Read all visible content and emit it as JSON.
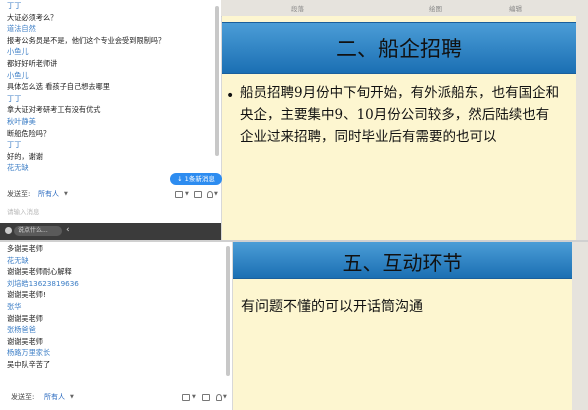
{
  "top": {
    "ribbon": [
      "段落",
      "绘图",
      "编辑"
    ],
    "messages": [
      {
        "type": "name",
        "text": "丁丁"
      },
      {
        "type": "text",
        "text": "大证必须考么？"
      },
      {
        "type": "name",
        "text": "道法自然"
      },
      {
        "type": "text",
        "text": "报考公务员是不是，他们这个专业会受到限制吗？"
      },
      {
        "type": "name",
        "text": "小鱼儿"
      },
      {
        "type": "text",
        "text": "都好好听老师讲"
      },
      {
        "type": "name",
        "text": "小鱼儿"
      },
      {
        "type": "text",
        "text": "具体怎么选 看孩子自己想去哪里"
      },
      {
        "type": "name",
        "text": "丁丁"
      },
      {
        "type": "text",
        "text": "拿大证对考研考工有没有优式"
      },
      {
        "type": "name",
        "text": "秋叶静美"
      },
      {
        "type": "text",
        "text": "断船危险吗？"
      },
      {
        "type": "name",
        "text": "丁丁"
      },
      {
        "type": "text",
        "text": "好的，谢谢"
      },
      {
        "type": "name",
        "text": "花无缺"
      }
    ],
    "new_message_badge": "↓ 1条新消息",
    "send_label": "发送至:",
    "send_target": "所有人",
    "input_placeholder": "请输入消息",
    "quick_placeholder": "说点什么...",
    "slide_title": "二、船企招聘",
    "slide_body": "船员招聘9月份中下旬开始，有外派船东，也有国企和央企，主要集中9、10月份公司较多，然后陆续也有企业过来招聘，同时毕业后有需要的也可以"
  },
  "bottom": {
    "messages": [
      {
        "type": "text",
        "text": "多谢吴老师"
      },
      {
        "type": "name",
        "text": "花无缺"
      },
      {
        "type": "text",
        "text": "谢谢吴老师耐心解释"
      },
      {
        "type": "name",
        "text": "刘培皓13623819636"
      },
      {
        "type": "text",
        "text": "谢谢吴老师!"
      },
      {
        "type": "name",
        "text": "张华"
      },
      {
        "type": "text",
        "text": "谢谢吴老师"
      },
      {
        "type": "name",
        "text": "张杨爸爸"
      },
      {
        "type": "text",
        "text": "谢谢吴老师"
      },
      {
        "type": "name",
        "text": "杨路万里家长"
      },
      {
        "type": "text",
        "text": "吴中队辛苦了"
      }
    ],
    "send_label": "发送至:",
    "send_target": "所有人",
    "slide_title": "五、互动环节",
    "slide_body": "有问题不懂的可以开话筒沟通"
  }
}
